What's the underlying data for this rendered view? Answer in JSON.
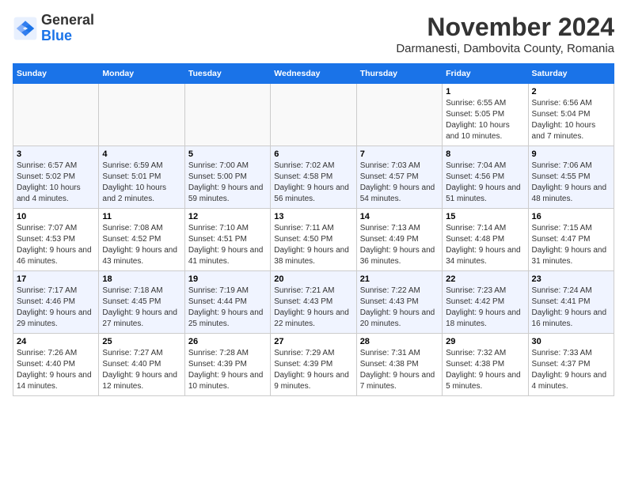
{
  "app": {
    "logo_general": "General",
    "logo_blue": "Blue"
  },
  "header": {
    "month": "November 2024",
    "location": "Darmanesti, Dambovita County, Romania"
  },
  "days_of_week": [
    "Sunday",
    "Monday",
    "Tuesday",
    "Wednesday",
    "Thursday",
    "Friday",
    "Saturday"
  ],
  "weeks": [
    [
      {
        "day": "",
        "info": ""
      },
      {
        "day": "",
        "info": ""
      },
      {
        "day": "",
        "info": ""
      },
      {
        "day": "",
        "info": ""
      },
      {
        "day": "",
        "info": ""
      },
      {
        "day": "1",
        "info": "Sunrise: 6:55 AM\nSunset: 5:05 PM\nDaylight: 10 hours and 10 minutes."
      },
      {
        "day": "2",
        "info": "Sunrise: 6:56 AM\nSunset: 5:04 PM\nDaylight: 10 hours and 7 minutes."
      }
    ],
    [
      {
        "day": "3",
        "info": "Sunrise: 6:57 AM\nSunset: 5:02 PM\nDaylight: 10 hours and 4 minutes."
      },
      {
        "day": "4",
        "info": "Sunrise: 6:59 AM\nSunset: 5:01 PM\nDaylight: 10 hours and 2 minutes."
      },
      {
        "day": "5",
        "info": "Sunrise: 7:00 AM\nSunset: 5:00 PM\nDaylight: 9 hours and 59 minutes."
      },
      {
        "day": "6",
        "info": "Sunrise: 7:02 AM\nSunset: 4:58 PM\nDaylight: 9 hours and 56 minutes."
      },
      {
        "day": "7",
        "info": "Sunrise: 7:03 AM\nSunset: 4:57 PM\nDaylight: 9 hours and 54 minutes."
      },
      {
        "day": "8",
        "info": "Sunrise: 7:04 AM\nSunset: 4:56 PM\nDaylight: 9 hours and 51 minutes."
      },
      {
        "day": "9",
        "info": "Sunrise: 7:06 AM\nSunset: 4:55 PM\nDaylight: 9 hours and 48 minutes."
      }
    ],
    [
      {
        "day": "10",
        "info": "Sunrise: 7:07 AM\nSunset: 4:53 PM\nDaylight: 9 hours and 46 minutes."
      },
      {
        "day": "11",
        "info": "Sunrise: 7:08 AM\nSunset: 4:52 PM\nDaylight: 9 hours and 43 minutes."
      },
      {
        "day": "12",
        "info": "Sunrise: 7:10 AM\nSunset: 4:51 PM\nDaylight: 9 hours and 41 minutes."
      },
      {
        "day": "13",
        "info": "Sunrise: 7:11 AM\nSunset: 4:50 PM\nDaylight: 9 hours and 38 minutes."
      },
      {
        "day": "14",
        "info": "Sunrise: 7:13 AM\nSunset: 4:49 PM\nDaylight: 9 hours and 36 minutes."
      },
      {
        "day": "15",
        "info": "Sunrise: 7:14 AM\nSunset: 4:48 PM\nDaylight: 9 hours and 34 minutes."
      },
      {
        "day": "16",
        "info": "Sunrise: 7:15 AM\nSunset: 4:47 PM\nDaylight: 9 hours and 31 minutes."
      }
    ],
    [
      {
        "day": "17",
        "info": "Sunrise: 7:17 AM\nSunset: 4:46 PM\nDaylight: 9 hours and 29 minutes."
      },
      {
        "day": "18",
        "info": "Sunrise: 7:18 AM\nSunset: 4:45 PM\nDaylight: 9 hours and 27 minutes."
      },
      {
        "day": "19",
        "info": "Sunrise: 7:19 AM\nSunset: 4:44 PM\nDaylight: 9 hours and 25 minutes."
      },
      {
        "day": "20",
        "info": "Sunrise: 7:21 AM\nSunset: 4:43 PM\nDaylight: 9 hours and 22 minutes."
      },
      {
        "day": "21",
        "info": "Sunrise: 7:22 AM\nSunset: 4:43 PM\nDaylight: 9 hours and 20 minutes."
      },
      {
        "day": "22",
        "info": "Sunrise: 7:23 AM\nSunset: 4:42 PM\nDaylight: 9 hours and 18 minutes."
      },
      {
        "day": "23",
        "info": "Sunrise: 7:24 AM\nSunset: 4:41 PM\nDaylight: 9 hours and 16 minutes."
      }
    ],
    [
      {
        "day": "24",
        "info": "Sunrise: 7:26 AM\nSunset: 4:40 PM\nDaylight: 9 hours and 14 minutes."
      },
      {
        "day": "25",
        "info": "Sunrise: 7:27 AM\nSunset: 4:40 PM\nDaylight: 9 hours and 12 minutes."
      },
      {
        "day": "26",
        "info": "Sunrise: 7:28 AM\nSunset: 4:39 PM\nDaylight: 9 hours and 10 minutes."
      },
      {
        "day": "27",
        "info": "Sunrise: 7:29 AM\nSunset: 4:39 PM\nDaylight: 9 hours and 9 minutes."
      },
      {
        "day": "28",
        "info": "Sunrise: 7:31 AM\nSunset: 4:38 PM\nDaylight: 9 hours and 7 minutes."
      },
      {
        "day": "29",
        "info": "Sunrise: 7:32 AM\nSunset: 4:38 PM\nDaylight: 9 hours and 5 minutes."
      },
      {
        "day": "30",
        "info": "Sunrise: 7:33 AM\nSunset: 4:37 PM\nDaylight: 9 hours and 4 minutes."
      }
    ]
  ]
}
